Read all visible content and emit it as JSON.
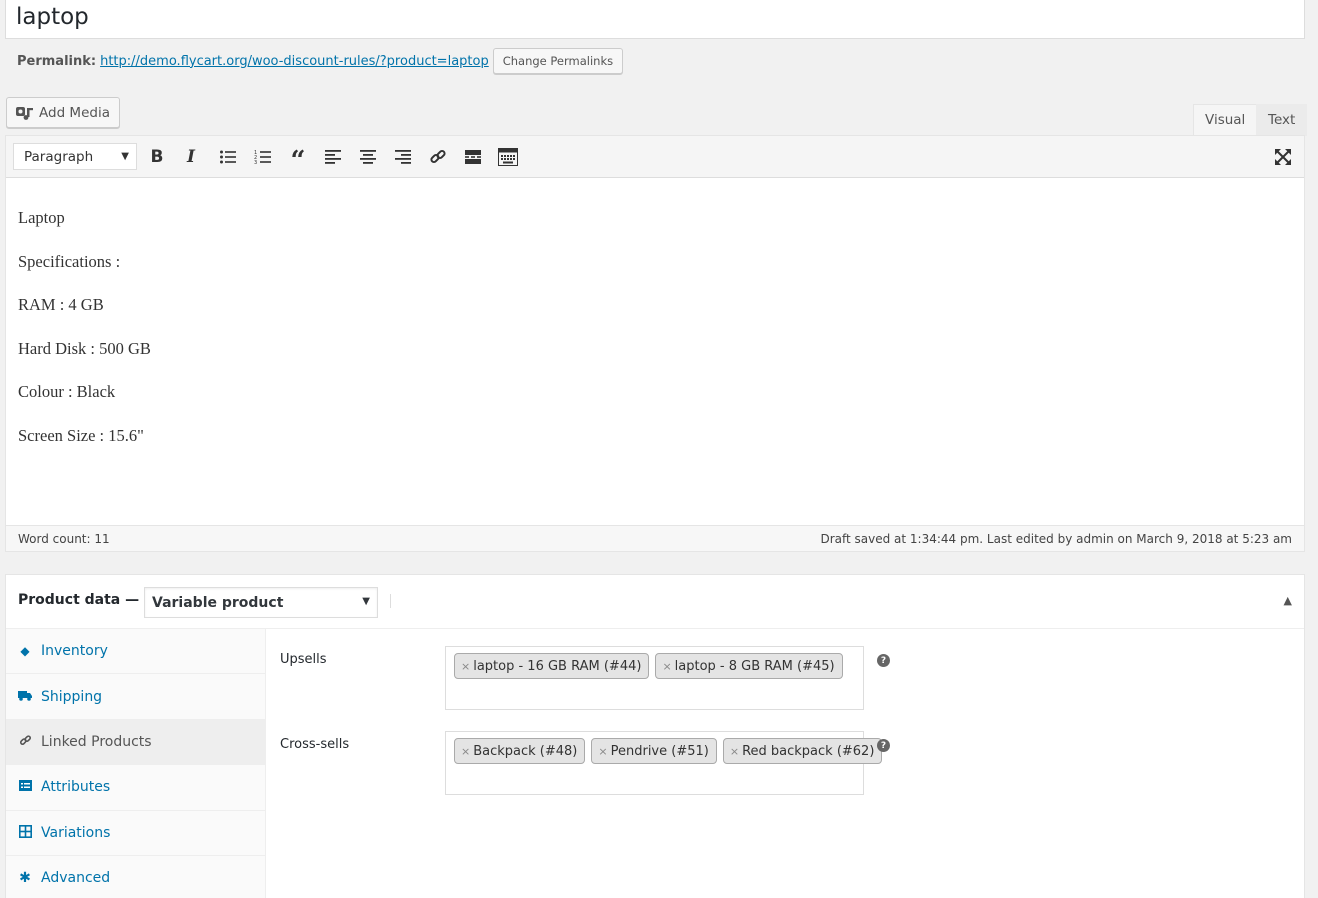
{
  "post": {
    "title": "laptop"
  },
  "permalink": {
    "label": "Permalink:",
    "url": "http://demo.flycart.org/woo-discount-rules/?product=laptop",
    "change_button": "Change Permalinks"
  },
  "media": {
    "add_label": "Add Media"
  },
  "editor_tabs": {
    "visual": "Visual",
    "text": "Text"
  },
  "toolbar": {
    "format_select": "Paragraph",
    "buttons": [
      "bold",
      "italic",
      "bulleted-list",
      "numbered-list",
      "blockquote",
      "align-left",
      "align-center",
      "align-right",
      "link",
      "read-more",
      "toolbar-toggle",
      "fullscreen"
    ]
  },
  "content": {
    "lines": [
      "Laptop",
      "Specifications :",
      "RAM : 4 GB",
      "Hard Disk : 500 GB",
      "Colour : Black",
      "Screen Size : 15.6\""
    ]
  },
  "status": {
    "word_count": "Word count: 11",
    "draft_info": "Draft saved at 1:34:44 pm. Last edited by admin on March 9, 2018 at 5:23 am"
  },
  "product_data": {
    "title": "Product data —",
    "product_type": "Variable product",
    "tabs": [
      {
        "label": "Inventory",
        "icon": "tag-icon"
      },
      {
        "label": "Shipping",
        "icon": "truck-icon"
      },
      {
        "label": "Linked Products",
        "icon": "link-icon",
        "active": true
      },
      {
        "label": "Attributes",
        "icon": "list-icon"
      },
      {
        "label": "Variations",
        "icon": "grid-icon"
      },
      {
        "label": "Advanced",
        "icon": "gear-icon"
      }
    ],
    "upsells": {
      "label": "Upsells",
      "items": [
        "laptop - 16 GB RAM (#44)",
        "laptop - 8 GB RAM (#45)"
      ]
    },
    "cross_sells": {
      "label": "Cross-sells",
      "items": [
        "Backpack (#48)",
        "Pendrive (#51)",
        "Red backpack (#62)"
      ]
    }
  },
  "colors": {
    "link": "#0073aa",
    "chip_bg": "#e4e4e4",
    "panel_bg": "#f1f1f1"
  }
}
